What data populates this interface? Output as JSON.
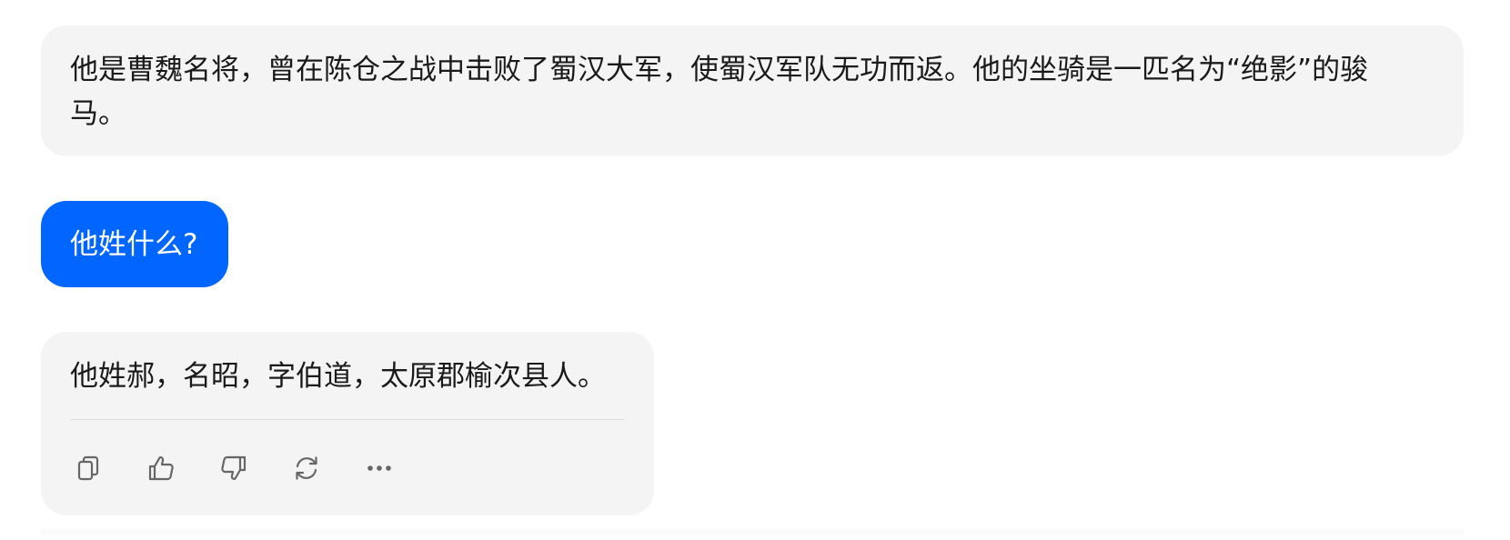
{
  "conversation": {
    "assistant_message_1": "他是曹魏名将，曾在陈仓之战中击败了蜀汉大军，使蜀汉军队无功而返。他的坐骑是一匹名为“绝影”的骏马。",
    "user_message_1": "他姓什么?",
    "assistant_message_2": "他姓郝，名昭，字伯道，太原郡榆次县人。"
  },
  "actions": [
    {
      "icon": "copy-icon"
    },
    {
      "icon": "thumbs-up-icon"
    },
    {
      "icon": "thumbs-down-icon"
    },
    {
      "icon": "regenerate-icon"
    },
    {
      "icon": "more-icon"
    }
  ],
  "colors": {
    "user_bubble": "#0066ff",
    "assistant_bubble": "#f4f4f4",
    "icon": "#666666"
  }
}
